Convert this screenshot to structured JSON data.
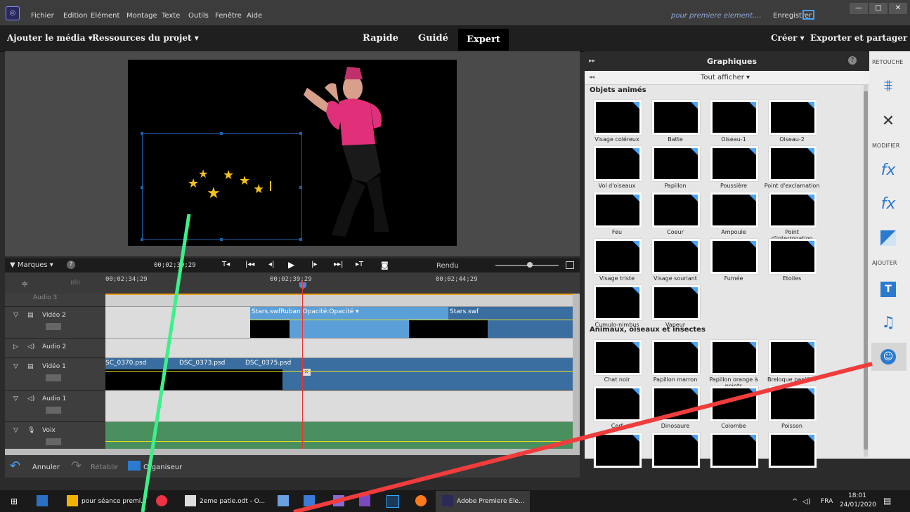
{
  "menu": [
    "Fichier",
    "Edition",
    "Elément",
    "Montage",
    "Texte",
    "Outils",
    "Fenêtre",
    "Aide"
  ],
  "window": {
    "document_title": "pour premiere element....",
    "save_label": "Enregistrer"
  },
  "topbar": {
    "add_media": "Ajouter le média ▾",
    "project_assets": "Ressources du projet ▾",
    "tab_quick": "Rapide",
    "tab_guided": "Guidé",
    "tab_expert": "Expert",
    "create": "Créer ▾",
    "export": "Exporter et partager"
  },
  "timeline": {
    "markers_label": "Marques ▾",
    "current_time": "00;02;39;29",
    "render_label": "Rendu",
    "ruler": [
      "00;02;34;29",
      "00;02;39;29",
      "00;02;44;29"
    ],
    "tracks": [
      {
        "name": "Vidéo 2",
        "clips": [
          "Stars.swfRuban Opacité:Opacité ▾",
          "Stars.swf"
        ]
      },
      {
        "name": "Audio 2",
        "clips": []
      },
      {
        "name": "Vidéo 1",
        "clips": [
          "SC_0370.psd",
          "DSC_0373.psd",
          "DSC_0375.psd"
        ]
      },
      {
        "name": "Audio 1",
        "clips": []
      },
      {
        "name": "Voix",
        "clips": []
      }
    ],
    "partial_track": "Audio 3"
  },
  "bottom": {
    "undo": "Annuler",
    "redo": "Rétablir",
    "organizer": "Organiseur"
  },
  "graphics": {
    "title": "Graphiques",
    "filter": "Tout afficher ▾",
    "section1": "Objets animés",
    "section1_items": [
      "Visage coléreux",
      "Batte",
      "Oiseau-1",
      "Oiseau-2",
      "Vol d'oiseaux",
      "Papillon",
      "Poussière",
      "Point d'exclamation",
      "Feu",
      "Coeur",
      "Ampoule",
      "Point d'interrogation",
      "Visage triste",
      "Visage souriant",
      "Fumée",
      "Etoiles",
      "Cumulo-nimbus",
      "Vapeur"
    ],
    "section2": "Animaux, oiseaux et insectes",
    "section2_items": [
      "Chat noir",
      "Papillon marron",
      "Papillon orange à points",
      "Breloque papillon",
      "Cerf",
      "Dinosaure",
      "Colombe",
      "Poisson",
      "",
      "",
      "",
      ""
    ]
  },
  "right_tools": {
    "retouche": "RETOUCHE",
    "modifier": "MODIFIER",
    "ajouter": "AJOUTER"
  },
  "taskbar": {
    "items": [
      "pour séance premi...",
      "2eme patie.odt - O...",
      "Adobe Premiere Ele..."
    ],
    "lang": "FRA",
    "time": "18:01",
    "date": "24/01/2020"
  }
}
